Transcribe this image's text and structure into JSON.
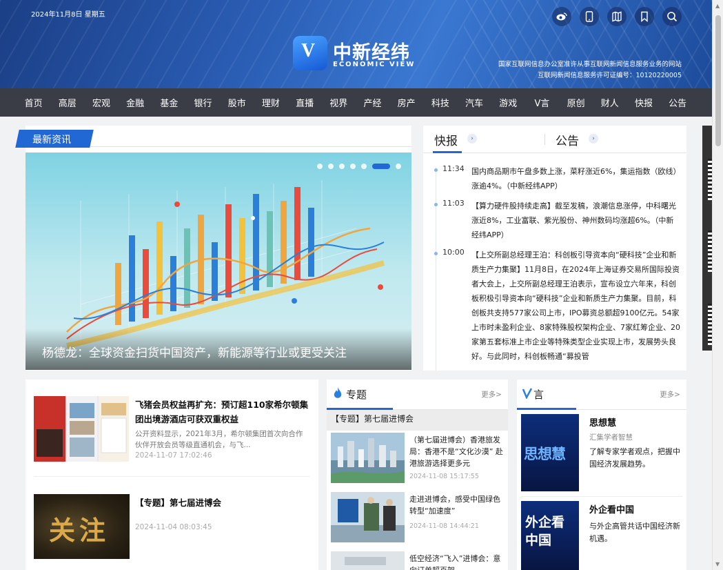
{
  "header": {
    "date": "2024年11月8日 星期五",
    "logo_cn": "中新经纬",
    "logo_en": "ECONOMIC VIEW",
    "license_line1": "国家互联网信息办公室准许从事互联网新闻信息服务业务的网站",
    "license_line2": "互联网新闻信息服务许可证编号：10120220005",
    "icons": [
      "weibo-icon",
      "mobile-icon",
      "map-icon",
      "bookmark-icon",
      "search-icon"
    ]
  },
  "nav": [
    "首页",
    "高层",
    "宏观",
    "金融",
    "基金",
    "银行",
    "股市",
    "理财",
    "直播",
    "视界",
    "产经",
    "房产",
    "科技",
    "汽车",
    "游戏",
    "V言",
    "原创",
    "财人",
    "快报",
    "公告"
  ],
  "latest": {
    "tag": "最新资讯",
    "caption": "杨德龙：全球资金扫货中国资产，新能源等行业或更受关注",
    "slides": 6,
    "active_slide": 6
  },
  "flash": {
    "tab1": "快报",
    "tab2": "公告",
    "items": [
      {
        "time": "11:34",
        "text": "国内商品期市午盘多数上涨，菜籽涨近6%，集运指数（欧线）涨逾4%。（中新经纬APP）"
      },
      {
        "time": "11:03",
        "text": "【算力硬件股持续走高】截至发稿，浪潮信息涨停，中科曙光涨近8%，工业富联、紫光股份、神州数码均涨超6%。（中新经纬APP）"
      },
      {
        "time": "10:00",
        "text": "【上交所副总经理王泊：科创板引导资本向“硬科技”企业和新质生产力集聚】11月8日，在2024年上海证券交易所国际投资者大会上，上交所副总经理王泊表示，宣布设立六年来，科创板积极引导资本向“硬科技”企业和新质生产力集聚。目前，科创板共支持577家公司上市，IPO募资总额超9100亿元。54家上市时未盈利企业、8家特殊股权架构企业、7家红筹企业、20家第五套标准上市企业等特殊类型企业实现上市，发展势头良好。与此同时，科创板畅通“募投管"
      }
    ]
  },
  "news": [
    {
      "title": "飞猪会员权益再扩充：预订超110家希尔顿集团出境游酒店可获双重权益",
      "desc": "公开资料显示，2021年3月，希尔顿集团首次向合作伙伴开放会员等级直通机会，与飞...",
      "date": "2024-11-07 17:02:46"
    },
    {
      "title": "【专题】第七届进博会",
      "desc": "",
      "date": "2024-11-04 08:03:45",
      "thumb_text": "关注"
    }
  ],
  "special": {
    "title": "专题",
    "more": "更多>",
    "subtitle": "【专题】第七届进博会",
    "items": [
      {
        "title": "（第七届进博会）香港旅发局：香港不是“文化沙漠” 赴港旅游选择更多元",
        "date": "2024-11-08 15:17:55"
      },
      {
        "title": "走进进博会，感受中国绿色转型“加速度”",
        "date": "2024-11-08 14:44:21"
      },
      {
        "title": "低空经济“飞入”进博会：意向订单超百架",
        "date": ""
      }
    ]
  },
  "vyan": {
    "title": "言",
    "more": "更多>",
    "items": [
      {
        "name": "思想慧",
        "sub": "汇集学者智慧",
        "desc": "了解专家学者观点，把握中国经济发展趋势。",
        "thumb_text": "思想慧"
      },
      {
        "name": "外企看中国",
        "sub": "",
        "desc": "与外企高管共话中国经济新机遇。",
        "thumb_text": "外企看中国"
      }
    ]
  },
  "colors": {
    "brand_blue": "#2168d4",
    "nav_bg": "#3a3d45"
  }
}
